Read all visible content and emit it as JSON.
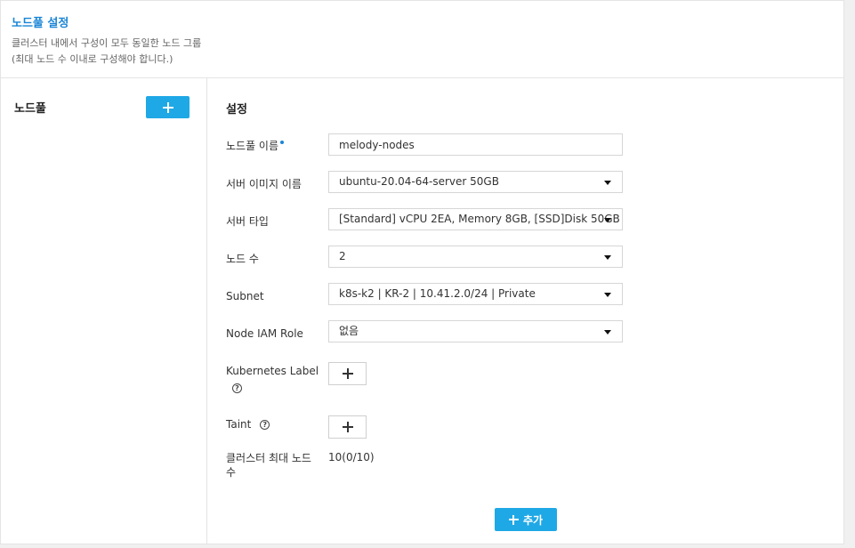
{
  "header": {
    "title": "노드풀 설정",
    "description_line1": "클러스터 내에서 구성이 모두 동일한 노드 그룹",
    "description_line2": "(최대 노드 수 이내로 구성해야 합니다.)"
  },
  "sidebar": {
    "label": "노드풀"
  },
  "settings": {
    "title": "설정",
    "nodepool_name": {
      "label": "노드풀 이름",
      "value": "melody-nodes",
      "required": true
    },
    "server_image": {
      "label": "서버 이미지 이름",
      "value": "ubuntu-20.04-64-server 50GB"
    },
    "server_type": {
      "label": "서버 타입",
      "value": "[Standard] vCPU 2EA, Memory 8GB, [SSD]Disk 50GB"
    },
    "node_count": {
      "label": "노드 수",
      "value": "2"
    },
    "subnet": {
      "label": "Subnet",
      "value": "k8s-k2 | KR-2 | 10.41.2.0/24 | Private"
    },
    "node_iam_role": {
      "label": "Node IAM Role",
      "value": "없음"
    },
    "kubernetes_label": {
      "label": "Kubernetes Label",
      "help_icon": "?"
    },
    "taint": {
      "label": "Taint",
      "help_icon": "?"
    },
    "max_nodes": {
      "label_line1": "클러스터 최대 노드",
      "label_line2": "수",
      "value": "10(0/10)"
    },
    "add_button_label": "추가"
  },
  "colors": {
    "accent": "#1fa8e6",
    "title_blue": "#1a85d6"
  }
}
